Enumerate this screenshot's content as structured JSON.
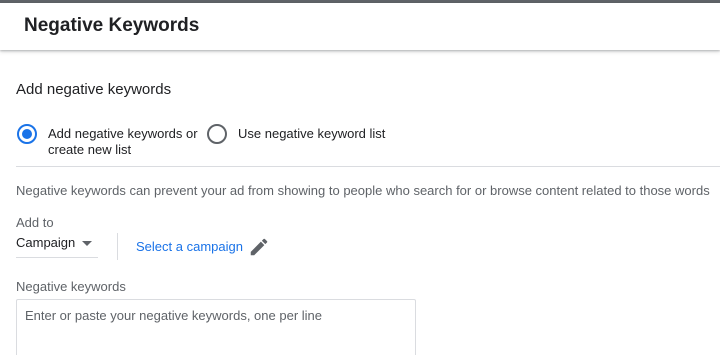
{
  "header": {
    "title": "Negative Keywords"
  },
  "section": {
    "title": "Add negative keywords"
  },
  "options": [
    {
      "label": "Add negative keywords or create new list",
      "checked": true
    },
    {
      "label": "Use negative keyword list",
      "checked": false
    }
  ],
  "helper_text": "Negative keywords can prevent your ad from showing to people who search for or browse content related to those words",
  "add_to": {
    "label": "Add to",
    "level_value": "Campaign",
    "select_link": "Select a campaign"
  },
  "negative_keywords": {
    "label": "Negative keywords",
    "placeholder": "Enter or paste your negative keywords, one per line",
    "value": ""
  },
  "colors": {
    "accent": "#1a73e8",
    "text": "#202124",
    "secondary_text": "#5f6368",
    "divider": "#dadce0"
  },
  "icons": [
    "radio-checked-icon",
    "radio-unchecked-icon",
    "dropdown-caret-icon",
    "pencil-icon"
  ]
}
